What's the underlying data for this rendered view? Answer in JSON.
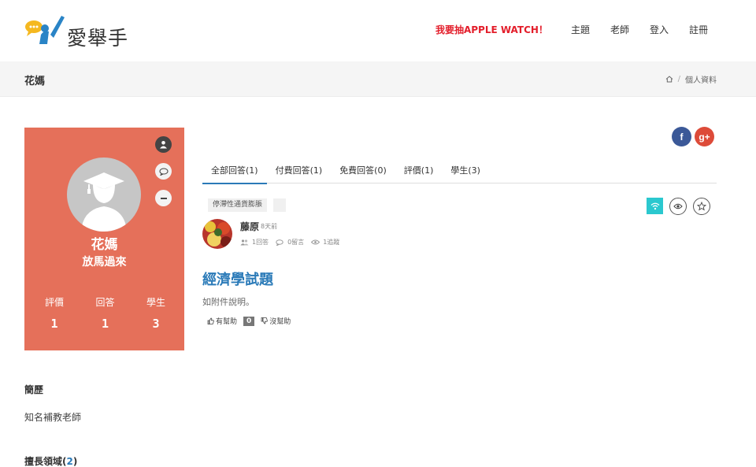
{
  "brand": {
    "logo_text": "愛舉手"
  },
  "nav": {
    "promo": "我要抽APPLE WATCH！",
    "topics": "主題",
    "teachers": "老師",
    "login": "登入",
    "register": "註冊"
  },
  "titlebar": {
    "title": "花媽",
    "crumb_current": "個人資料",
    "crumb_separator": "/"
  },
  "profile": {
    "name": "花媽",
    "subtitle": "放馬過來",
    "stats": [
      {
        "label": "評價",
        "value": "1"
      },
      {
        "label": "回答",
        "value": "1"
      },
      {
        "label": "學生",
        "value": "3"
      }
    ],
    "card_color": "#e5705a"
  },
  "bio": {
    "resume_title": "簡歷",
    "resume_text": "知名補教老師",
    "expertise_title": "擅長領域",
    "expertise_count_open": "(",
    "expertise_count": "2",
    "expertise_count_close": ")"
  },
  "social": {
    "facebook": "f",
    "googleplus": "g+"
  },
  "tabs": [
    {
      "label": "全部回答(1)",
      "active": true
    },
    {
      "label": "付費回答(1)",
      "active": false
    },
    {
      "label": "免費回答(0)",
      "active": false
    },
    {
      "label": "評價(1)",
      "active": false
    },
    {
      "label": "學生(3)",
      "active": false
    }
  ],
  "question": {
    "tag": "停滯性通貨膨脹",
    "user_name": "藤原",
    "time": "8天前",
    "answers": "1回答",
    "comments": "0留言",
    "follows": "1追蹤",
    "title": "經濟學試題",
    "description": "如附件說明。",
    "helpful_label": "有幫助",
    "helpful_count": "0",
    "unhelpful_label": "沒幫助"
  },
  "colors": {
    "accent": "#2a7ab8",
    "promo": "#e31e2b",
    "teal": "#2bc8cf",
    "facebook": "#3b5998",
    "googleplus": "#dd4b39"
  }
}
